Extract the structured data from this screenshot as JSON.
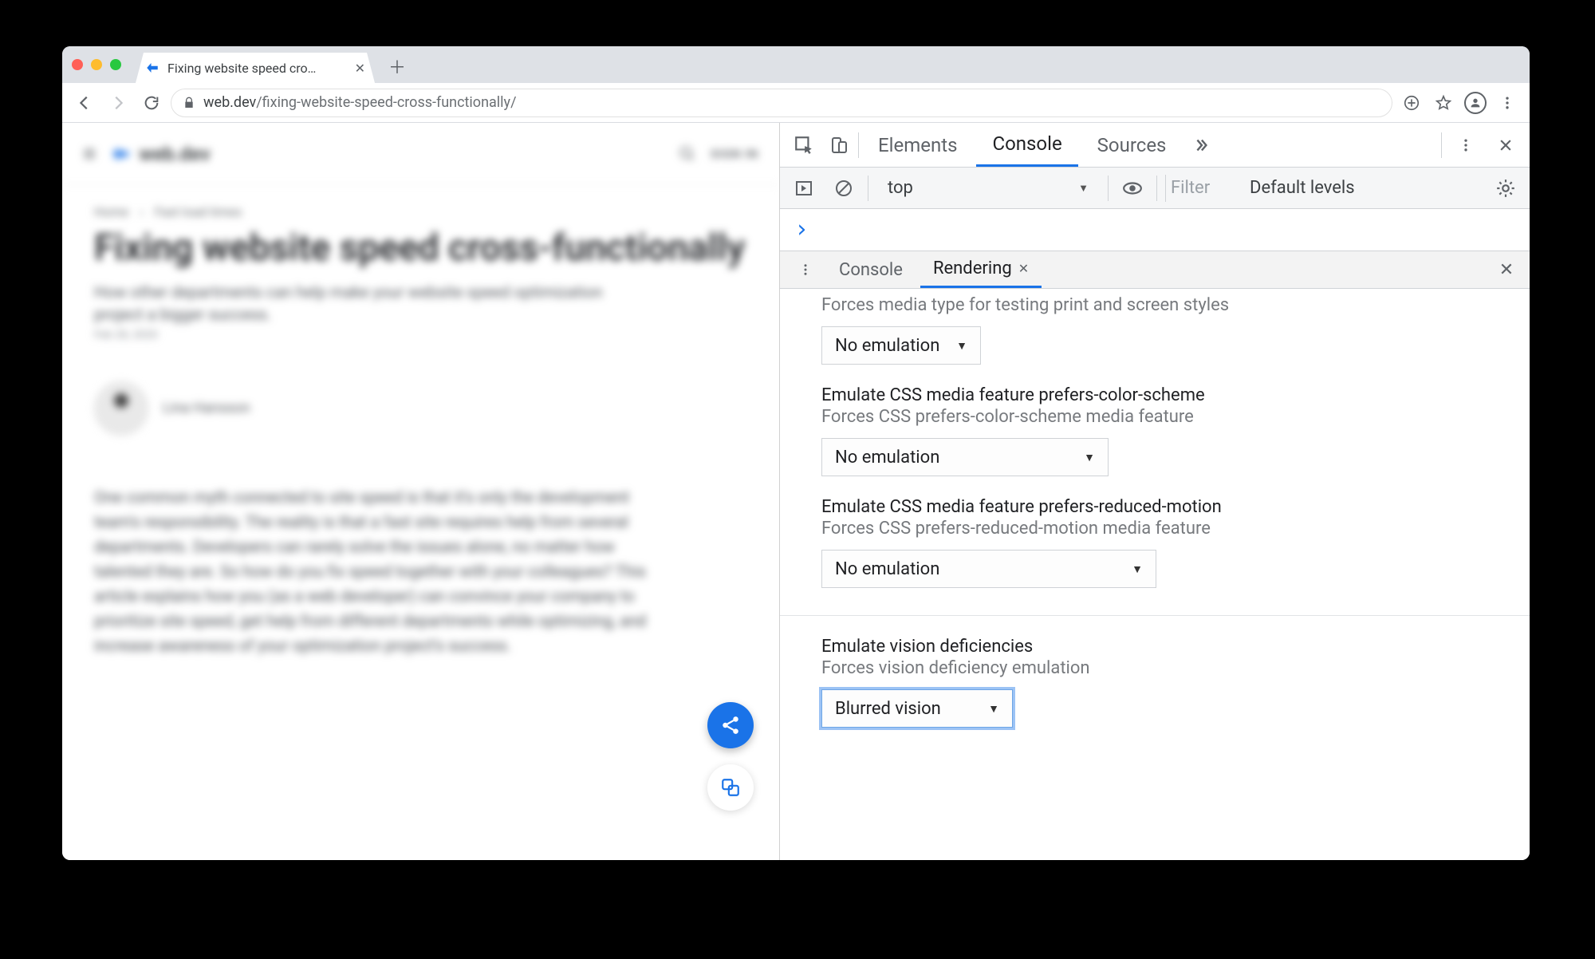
{
  "browser": {
    "tab_title": "Fixing website speed cross-fu",
    "url_host": "web.dev",
    "url_path": "/fixing-website-speed-cross-functionally/"
  },
  "page": {
    "brand": "web.dev",
    "signin": "SIGN IN",
    "crumb1": "Home",
    "crumb2": "Fast load times",
    "title": "Fixing website speed cross-functionally",
    "subtitle": "How other departments can help make your website speed optimization project a bigger success.",
    "date": "Feb 28, 2020",
    "author": "Lina Hansson",
    "body": "One common myth connected to site speed is that it's only the development team's responsibility. The reality is that a fast site requires help from several departments. Developers can rarely solve the issues alone, no matter how talented they are. So how do you fix speed together with your colleagues? This article explains how you (as a web developer) can convince your company to prioritize site speed, get help from different departments while optimizing, and increase awareness of your optimization project's success."
  },
  "devtools": {
    "tabs": {
      "elements": "Elements",
      "console": "Console",
      "sources": "Sources"
    },
    "subbar": {
      "context": "top",
      "filter_placeholder": "Filter",
      "levels": "Default levels "
    },
    "console_prompt": "›",
    "drawer_tabs": {
      "console": "Console",
      "rendering": "Rendering"
    },
    "rendering": {
      "media_desc": "Forces media type for testing print and screen styles",
      "media_value": "No emulation",
      "pcs_title": "Emulate CSS media feature prefers-color-scheme",
      "pcs_desc": "Forces CSS prefers-color-scheme media feature",
      "pcs_value": "No emulation",
      "prm_title": "Emulate CSS media feature prefers-reduced-motion",
      "prm_desc": "Forces CSS prefers-reduced-motion media feature",
      "prm_value": "No emulation",
      "vision_title": "Emulate vision deficiencies",
      "vision_desc": "Forces vision deficiency emulation",
      "vision_value": "Blurred vision"
    }
  }
}
